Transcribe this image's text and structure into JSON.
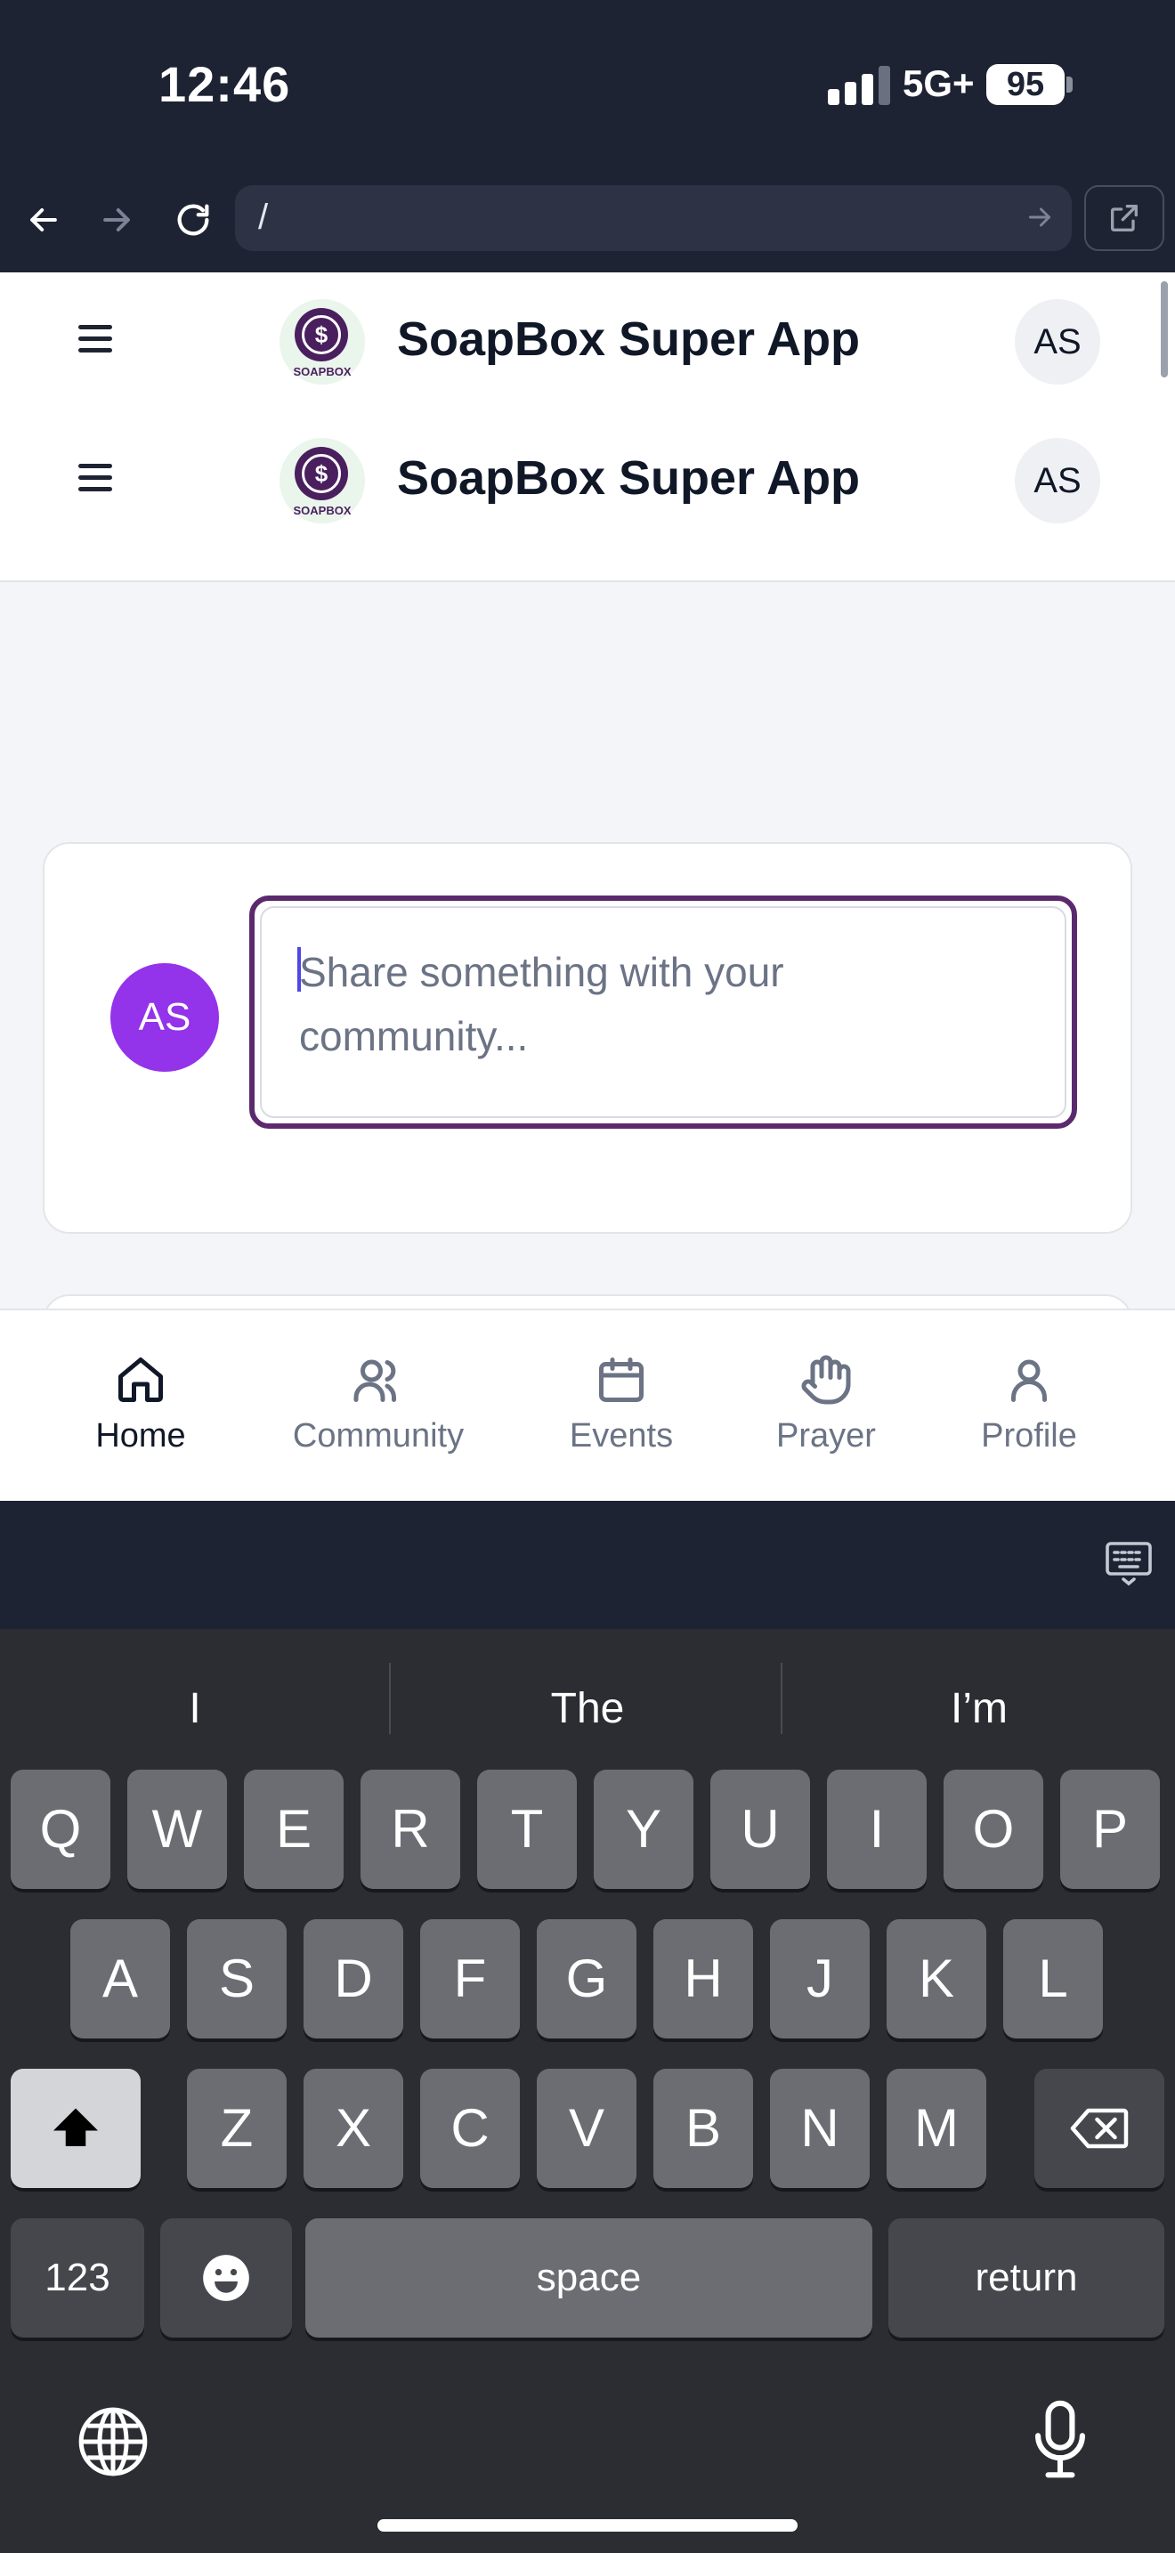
{
  "status_bar": {
    "time": "12:46",
    "network": "5G+",
    "battery": "95"
  },
  "browser": {
    "url": "/",
    "icons": [
      "back-arrow-icon",
      "forward-arrow-icon",
      "reload-icon",
      "go-arrow-icon",
      "external-link-icon"
    ]
  },
  "header": {
    "title": "SoapBox Super App",
    "logo_text": "SOAPBOX",
    "user_initials": "AS"
  },
  "composer": {
    "user_initials": "AS",
    "placeholder": "Share something with your community..."
  },
  "tabs": [
    {
      "label": "Home",
      "icon": "home-icon",
      "active": true
    },
    {
      "label": "Community",
      "icon": "users-icon",
      "active": false
    },
    {
      "label": "Events",
      "icon": "calendar-icon",
      "active": false
    },
    {
      "label": "Prayer",
      "icon": "hand-icon",
      "active": false
    },
    {
      "label": "Profile",
      "icon": "user-icon",
      "active": false
    }
  ],
  "keyboard": {
    "suggestions": [
      "I",
      "The",
      "I’m"
    ],
    "row1": [
      "Q",
      "W",
      "E",
      "R",
      "T",
      "Y",
      "U",
      "I",
      "O",
      "P"
    ],
    "row2": [
      "A",
      "S",
      "D",
      "F",
      "G",
      "H",
      "J",
      "K",
      "L"
    ],
    "row3": [
      "Z",
      "X",
      "C",
      "V",
      "B",
      "N",
      "M"
    ],
    "numbers_label": "123",
    "space_label": "space",
    "return_label": "return"
  },
  "colors": {
    "accent": "#5b2a6e",
    "avatar": "#9333ea",
    "chrome": "#1e2333"
  }
}
